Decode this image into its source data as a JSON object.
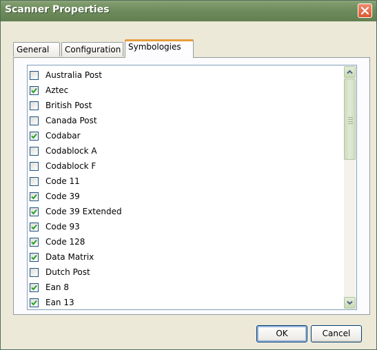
{
  "window": {
    "title": "Scanner Properties",
    "close_icon": "close-icon"
  },
  "tabs": [
    {
      "label": "General",
      "active": false
    },
    {
      "label": "Configuration",
      "active": false
    },
    {
      "label": "Symbologies",
      "active": true
    }
  ],
  "symbologies": [
    {
      "label": "Australia Post",
      "checked": false
    },
    {
      "label": "Aztec",
      "checked": true
    },
    {
      "label": "British Post",
      "checked": false
    },
    {
      "label": "Canada Post",
      "checked": false
    },
    {
      "label": "Codabar",
      "checked": true
    },
    {
      "label": "Codablock A",
      "checked": false
    },
    {
      "label": "Codablock F",
      "checked": false
    },
    {
      "label": "Code 11",
      "checked": false
    },
    {
      "label": "Code 39",
      "checked": true
    },
    {
      "label": "Code 39 Extended",
      "checked": true
    },
    {
      "label": "Code 93",
      "checked": true
    },
    {
      "label": "Code 128",
      "checked": true
    },
    {
      "label": "Data Matrix",
      "checked": true
    },
    {
      "label": "Dutch Post",
      "checked": false
    },
    {
      "label": "Ean 8",
      "checked": true
    },
    {
      "label": "Ean 13",
      "checked": true
    }
  ],
  "buttons": {
    "ok": "OK",
    "cancel": "Cancel"
  },
  "colors": {
    "titlebar": "#6f8c5d",
    "close_button": "#d9582f",
    "active_tab_accent": "#e89b3c",
    "check_mark": "#21a121"
  }
}
